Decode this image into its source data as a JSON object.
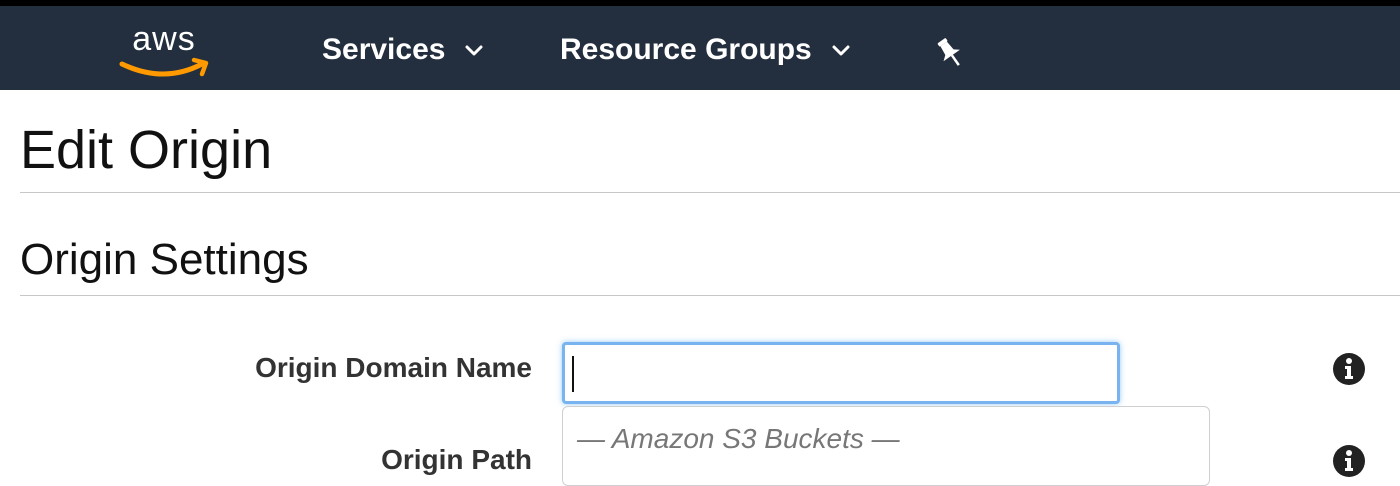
{
  "header": {
    "logo_text": "aws",
    "nav": [
      {
        "label": "Services"
      },
      {
        "label": "Resource Groups"
      }
    ]
  },
  "page": {
    "title": "Edit Origin"
  },
  "section": {
    "title": "Origin Settings"
  },
  "form": {
    "origin_domain_name_label": "Origin Domain Name",
    "origin_domain_name_value": "",
    "origin_path_label": "Origin Path"
  },
  "dropdown": {
    "group_label": "— Amazon S3 Buckets —"
  },
  "colors": {
    "topbar": "#232f3e",
    "logo_smile": "#ff9900",
    "input_focus": "#79b3f0"
  },
  "icons": [
    "chevron-down-icon",
    "pin-icon",
    "info-icon"
  ]
}
